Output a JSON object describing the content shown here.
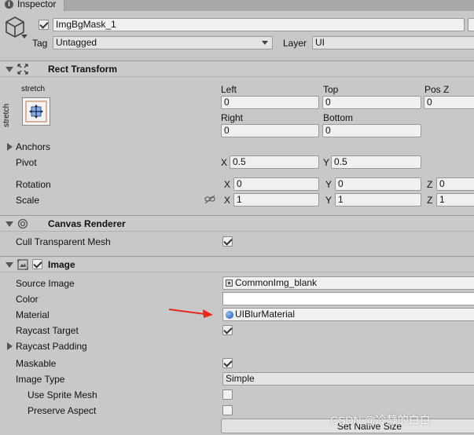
{
  "tab": {
    "label": "Inspector"
  },
  "header": {
    "object_name": "ImgBgMask_1",
    "tag_label": "Tag",
    "tag_value": "Untagged",
    "layer_label": "Layer",
    "layer_value": "UI"
  },
  "rect_transform": {
    "title": "Rect Transform",
    "anchor_preset_label_top": "stretch",
    "anchor_preset_label_side": "stretch",
    "left_label": "Left",
    "left_value": "0",
    "top_label": "Top",
    "top_value": "0",
    "posz_label": "Pos Z",
    "posz_value": "0",
    "right_label": "Right",
    "right_value": "0",
    "bottom_label": "Bottom",
    "bottom_value": "0",
    "anchors_label": "Anchors",
    "pivot_label": "Pivot",
    "pivot_x": "0.5",
    "pivot_y": "0.5",
    "rotation_label": "Rotation",
    "rot_x": "0",
    "rot_y": "0",
    "rot_z": "0",
    "scale_label": "Scale",
    "scale_x": "1",
    "scale_y": "1",
    "scale_z": "1",
    "x_axis": "X",
    "y_axis": "Y",
    "z_axis": "Z"
  },
  "canvas_renderer": {
    "title": "Canvas Renderer",
    "cull_label": "Cull Transparent Mesh",
    "cull_checked": true
  },
  "image": {
    "title": "Image",
    "enabled": true,
    "source_image_label": "Source Image",
    "source_image_value": "CommonImg_blank",
    "color_label": "Color",
    "color_value": "#ffffff",
    "material_label": "Material",
    "material_value": "UIBlurMaterial",
    "raycast_target_label": "Raycast Target",
    "raycast_target_checked": true,
    "raycast_padding_label": "Raycast Padding",
    "maskable_label": "Maskable",
    "maskable_checked": true,
    "image_type_label": "Image Type",
    "image_type_value": "Simple",
    "use_sprite_mesh_label": "Use Sprite Mesh",
    "use_sprite_mesh_checked": false,
    "preserve_aspect_label": "Preserve Aspect",
    "preserve_aspect_checked": false,
    "set_native_size_label": "Set Native Size"
  },
  "annotation": {
    "arrow_color": "#e8291c"
  },
  "watermark": "CSDN @冷静的白白"
}
